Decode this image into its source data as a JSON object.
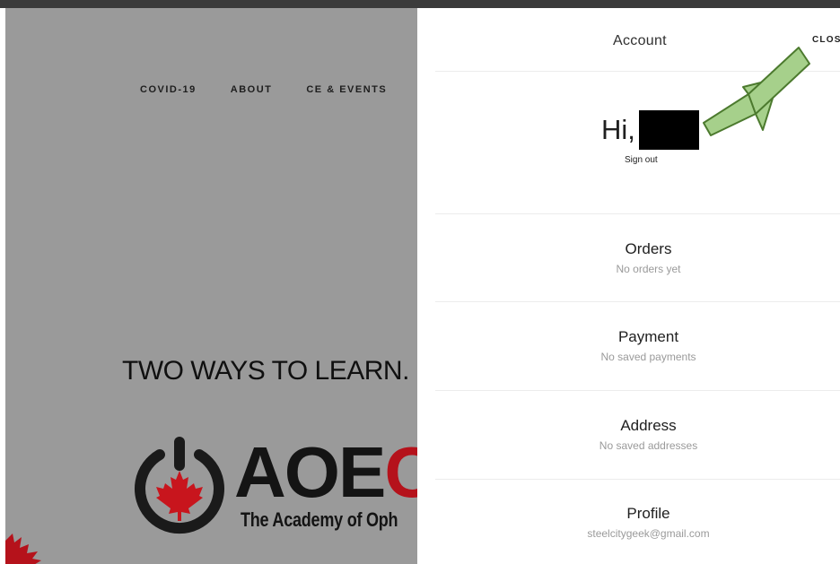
{
  "site": {
    "nav": [
      "COVID-19",
      "ABOUT",
      "CE & EVENTS"
    ],
    "hero_text": "TWO WAYS TO LEARN.",
    "logo": {
      "main": "AOE",
      "accent": "C",
      "sub": "The Academy of Oph"
    }
  },
  "panel": {
    "title": "Account",
    "close_label": "CLOS",
    "greeting": "Hi,",
    "sign_out": "Sign out",
    "sections": [
      {
        "title": "Orders",
        "subtitle": "No orders yet"
      },
      {
        "title": "Payment",
        "subtitle": "No saved payments"
      },
      {
        "title": "Address",
        "subtitle": "No saved addresses"
      },
      {
        "title": "Profile",
        "subtitle": "steelcitygeek@gmail.com"
      }
    ]
  },
  "colors": {
    "overlay": "#9a9a9a",
    "brand_red": "#b5121b",
    "arrow_fill": "#a6d08b",
    "arrow_stroke": "#4c7a2e"
  },
  "icons": {
    "logo_mark": "power-maple-leaf-icon",
    "annotation": "green-arrow-icon"
  }
}
